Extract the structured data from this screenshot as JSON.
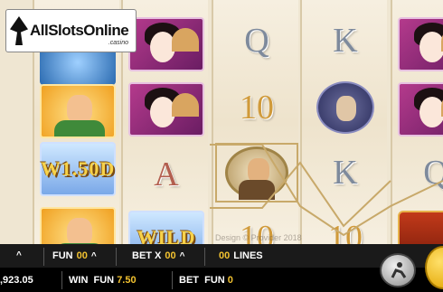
{
  "brand": {
    "name": "AllSlotsOnline",
    "sub": ".casino"
  },
  "watermark": "Design © Provider 2018",
  "reels": [
    [
      "blue-swirl",
      "samurai-yellow",
      "w150-bonus",
      "samurai-yellow-partial"
    ],
    [
      "geisha",
      "geisha",
      "A",
      "WILD"
    ],
    [
      "Q",
      "10",
      "warrior",
      "10"
    ],
    [
      "K",
      "monk",
      "K",
      "10"
    ],
    [
      "geisha",
      "geisha",
      "Q",
      "chest"
    ]
  ],
  "symbols": {
    "bonus_label": "W1.50D",
    "wild_label": "WILD"
  },
  "bottom_bar": {
    "left_caret": "^",
    "fun_label": "FUN",
    "fun_value": "00",
    "betx_label": "BET X",
    "betx_value": "00",
    "lines_value": "00",
    "lines_label": "LINES"
  },
  "info_bar": {
    "balance": ",923.05",
    "win_label": "WIN",
    "win_fun_label": "FUN",
    "win_value": "7.50",
    "bet_label": "BET",
    "bet_fun_label": "FUN",
    "bet_value": "0"
  },
  "colors": {
    "gold": "#f2c230",
    "reel_bg": "#efe6d2",
    "bar_bg": "#1a1a1a"
  }
}
